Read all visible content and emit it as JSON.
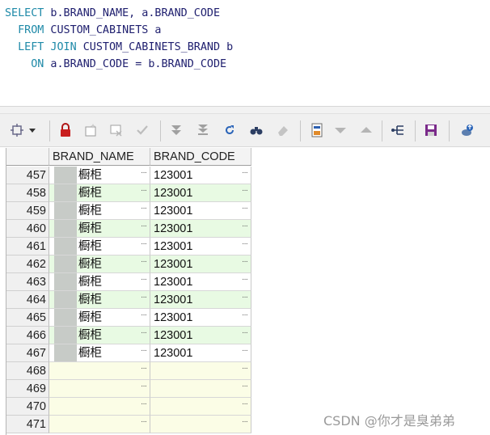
{
  "editor": {
    "line1_kw": "SELECT",
    "line1_rest": " b.BRAND_NAME, a.BRAND_CODE",
    "line2_kw": "  FROM",
    "line2_rest": " CUSTOM_CABINETS a",
    "line3_kw": "  LEFT JOIN",
    "line3_rest": " CUSTOM_CABINETS_BRAND b",
    "line4_kw": "    ON",
    "line4_rest": " a.BRAND_CODE = b.BRAND_CODE"
  },
  "toolbar": {
    "icons": [
      "select-mode-icon",
      "dropdown-arrow-icon",
      "lock-icon",
      "insert-record-icon",
      "delete-record-icon",
      "post-changes-icon",
      "fetch-next-icon",
      "fetch-last-icon",
      "refresh-icon",
      "find-icon",
      "clear-icon",
      "single-record-view-icon",
      "sort-descending-icon",
      "sort-ascending-icon",
      "query-by-example-icon",
      "save-icon",
      "export-icon"
    ]
  },
  "grid": {
    "columns": [
      "BRAND_NAME",
      "BRAND_CODE"
    ],
    "rows": [
      {
        "num": "457",
        "name": "橱柜",
        "code": "123001",
        "style": "white"
      },
      {
        "num": "458",
        "name": "橱柜",
        "code": "123001",
        "style": "green"
      },
      {
        "num": "459",
        "name": "橱柜",
        "code": "123001",
        "style": "white"
      },
      {
        "num": "460",
        "name": "橱柜",
        "code": "123001",
        "style": "green"
      },
      {
        "num": "461",
        "name": "橱柜",
        "code": "123001",
        "style": "white"
      },
      {
        "num": "462",
        "name": "橱柜",
        "code": "123001",
        "style": "green"
      },
      {
        "num": "463",
        "name": "橱柜",
        "code": "123001",
        "style": "white"
      },
      {
        "num": "464",
        "name": "橱柜",
        "code": "123001",
        "style": "green"
      },
      {
        "num": "465",
        "name": "橱柜",
        "code": "123001",
        "style": "white"
      },
      {
        "num": "466",
        "name": "橱柜",
        "code": "123001",
        "style": "green"
      },
      {
        "num": "467",
        "name": "橱柜",
        "code": "123001",
        "style": "white"
      },
      {
        "num": "468",
        "name": "",
        "code": "",
        "style": "empty"
      },
      {
        "num": "469",
        "name": "",
        "code": "",
        "style": "empty"
      },
      {
        "num": "470",
        "name": "",
        "code": "",
        "style": "empty"
      },
      {
        "num": "471",
        "name": "",
        "code": "",
        "style": "empty"
      }
    ],
    "ellipsis": "···"
  },
  "watermark": "CSDN @你才是臭弟弟",
  "colors": {
    "keyword": "#1f8aa8",
    "identifier": "#1e1e6e",
    "row_alt": "#e8fae3",
    "row_empty": "#fbfde6"
  }
}
